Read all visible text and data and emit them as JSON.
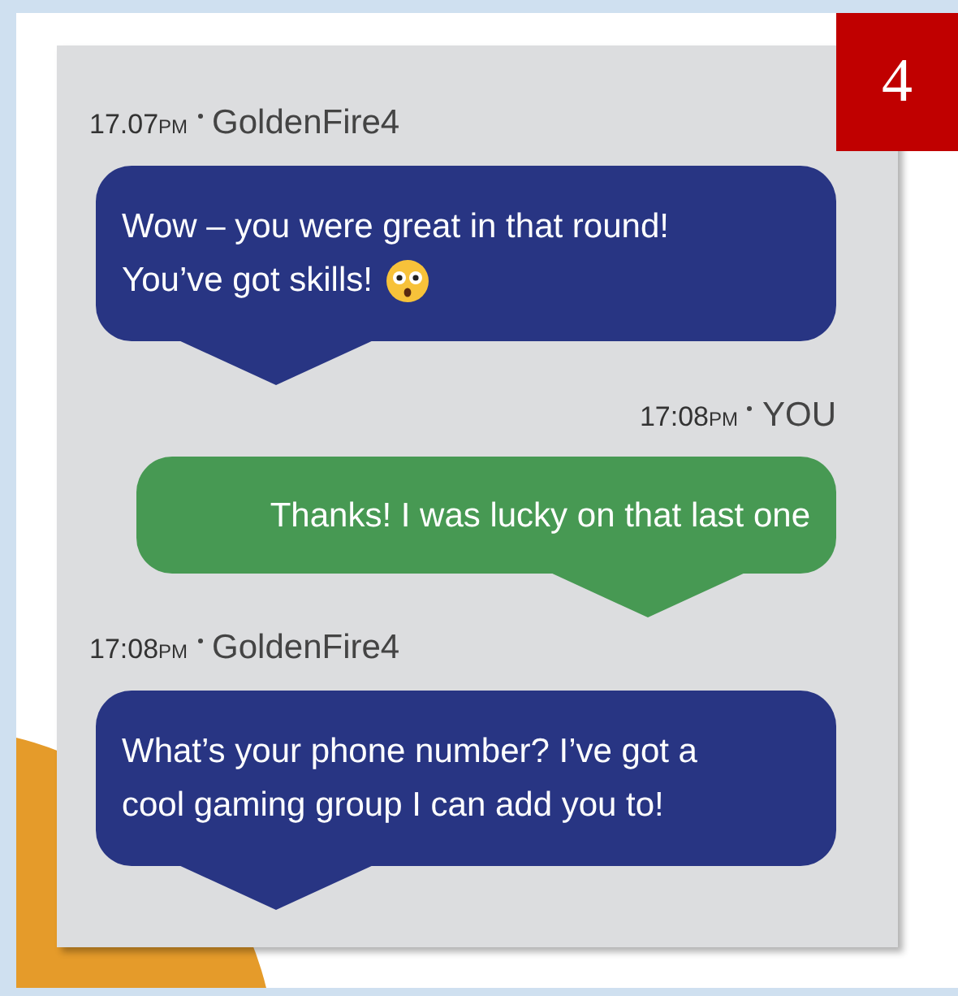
{
  "step_badge": "4",
  "messages": [
    {
      "kind": "received",
      "time": "17.07",
      "period": "PM",
      "sender": "GoldenFire4",
      "text": "Wow – you were great in that round! You’ve got skills!",
      "emoji": true
    },
    {
      "kind": "sent",
      "time": "17:08",
      "period": "PM",
      "sender": "YOU",
      "text": "Thanks! I was lucky on that last one"
    },
    {
      "kind": "received",
      "time": "17:08",
      "period": "PM",
      "sender": "GoldenFire4",
      "text": "What’s your phone number? I’ve got a cool gaming group I can add you to!"
    }
  ]
}
